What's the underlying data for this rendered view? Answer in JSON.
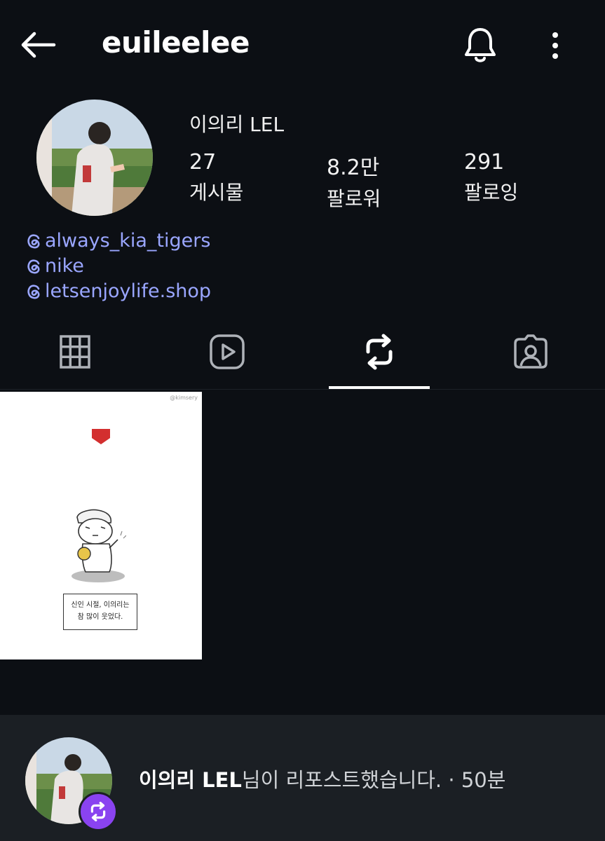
{
  "header": {
    "username": "euileelee",
    "back_icon": "arrow-left-icon",
    "notification_icon": "bell-icon",
    "more_icon": "more-vertical-icon"
  },
  "profile": {
    "display_name": "이의리 LEL",
    "stats": [
      {
        "value": "27",
        "label": "게시물"
      },
      {
        "value": "8.2만",
        "label": "팔로워"
      },
      {
        "value": "291",
        "label": "팔로잉"
      }
    ],
    "links": [
      "always_kia_tigers",
      "nike",
      "letsenjoylife.shop"
    ]
  },
  "tabs": [
    {
      "icon": "grid-icon",
      "active": false
    },
    {
      "icon": "reels-icon",
      "active": false
    },
    {
      "icon": "repost-icon",
      "active": true
    },
    {
      "icon": "tagged-icon",
      "active": false
    }
  ],
  "post": {
    "watermark": "@kimsery",
    "caption_line1": "신인 시절, 이의리는",
    "caption_line2": "참 많이 웃었다."
  },
  "footer": {
    "name": "이의리 LEL",
    "action": "님이 리포스트했습니다.",
    "separator": " · ",
    "time": "50분"
  },
  "colors": {
    "background": "#0c0f14",
    "link": "#9aa6ff",
    "badge": "#8a43f0",
    "footer_bg": "#1b1f24"
  }
}
